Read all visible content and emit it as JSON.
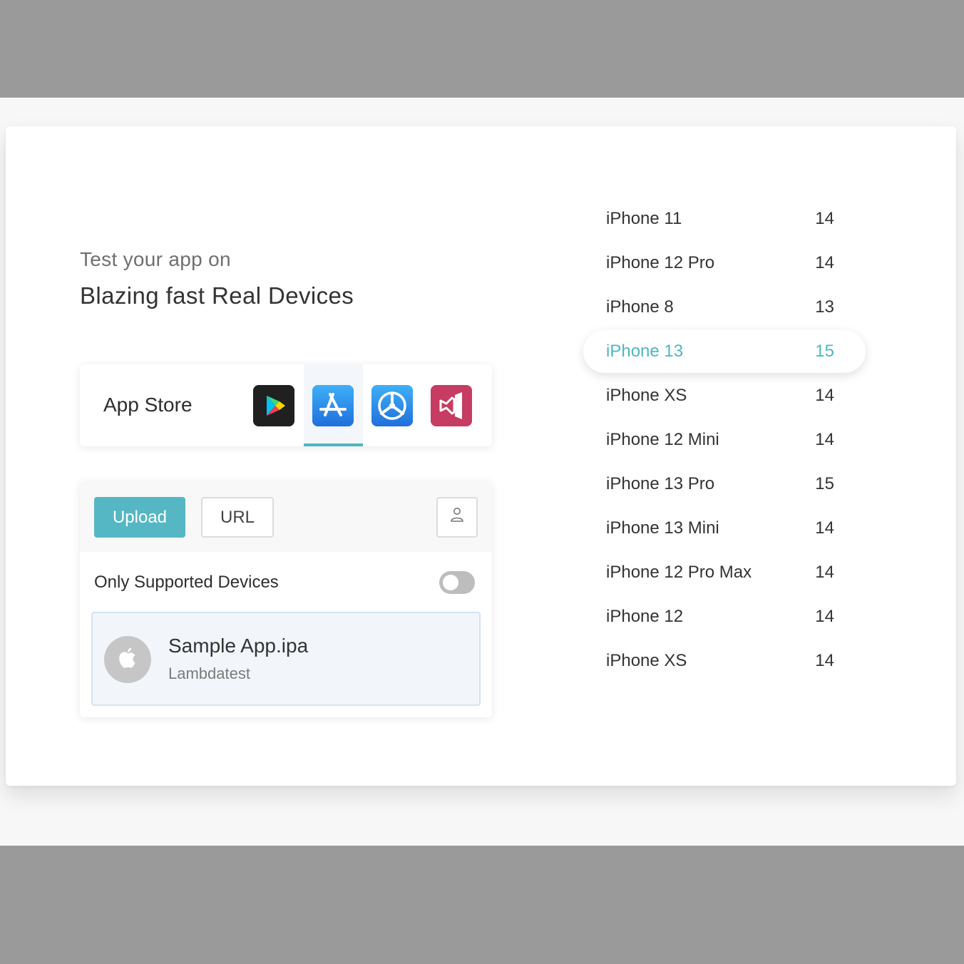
{
  "hero": {
    "subtitle": "Test your app on",
    "title": "Blazing fast Real Devices"
  },
  "store": {
    "label": "App Store",
    "tabs": [
      {
        "name": "google-play-icon",
        "active": false
      },
      {
        "name": "app-store-icon",
        "active": true
      },
      {
        "name": "testflight-icon",
        "active": false
      },
      {
        "name": "app-center-icon",
        "active": false
      }
    ],
    "accent_color": "#4fb6c4"
  },
  "upload": {
    "upload_label": "Upload",
    "url_label": "URL",
    "user_icon": "user-icon",
    "only_supported_label": "Only Supported Devices",
    "only_supported_enabled": false,
    "file": {
      "name": "Sample App.ipa",
      "subtitle": "Lambdatest",
      "icon": "apple-icon"
    }
  },
  "devices": [
    {
      "name": "iPhone 11",
      "version": "14",
      "selected": false
    },
    {
      "name": "iPhone 12 Pro",
      "version": "14",
      "selected": false
    },
    {
      "name": "iPhone 8",
      "version": "13",
      "selected": false
    },
    {
      "name": "iPhone 13",
      "version": "15",
      "selected": true
    },
    {
      "name": "iPhone XS",
      "version": "14",
      "selected": false
    },
    {
      "name": "iPhone 12 Mini",
      "version": "14",
      "selected": false
    },
    {
      "name": "iPhone 13 Pro",
      "version": "15",
      "selected": false
    },
    {
      "name": "iPhone 13 Mini",
      "version": "14",
      "selected": false
    },
    {
      "name": "iPhone 12 Pro Max",
      "version": "14",
      "selected": false
    },
    {
      "name": "iPhone 12",
      "version": "14",
      "selected": false
    },
    {
      "name": "iPhone XS",
      "version": "14",
      "selected": false
    }
  ]
}
